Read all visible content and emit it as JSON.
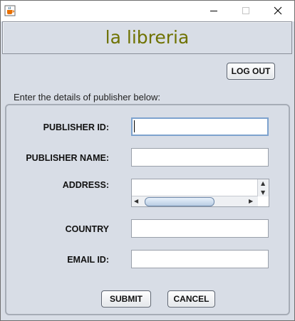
{
  "window": {
    "icon": "java-cup-icon",
    "controls": [
      "minimize-icon",
      "maximize-icon",
      "close-icon"
    ]
  },
  "header": {
    "title": "la libreria"
  },
  "toolbar": {
    "logout_label": "LOG OUT"
  },
  "form": {
    "instructions": "Enter the details of publisher below:",
    "fields": {
      "publisher_id": {
        "label": "PUBLISHER ID:",
        "value": ""
      },
      "publisher_name": {
        "label": "PUBLISHER NAME:",
        "value": ""
      },
      "address": {
        "label": "ADDRESS:",
        "value": ""
      },
      "country": {
        "label": "COUNTRY",
        "value": ""
      },
      "email_id": {
        "label": "EMAIL ID:",
        "value": ""
      }
    },
    "submit_label": "SUBMIT",
    "cancel_label": "CANCEL"
  },
  "colors": {
    "background": "#d8dde6",
    "title_text": "#6f7200",
    "focus_border": "#7da2ce"
  }
}
